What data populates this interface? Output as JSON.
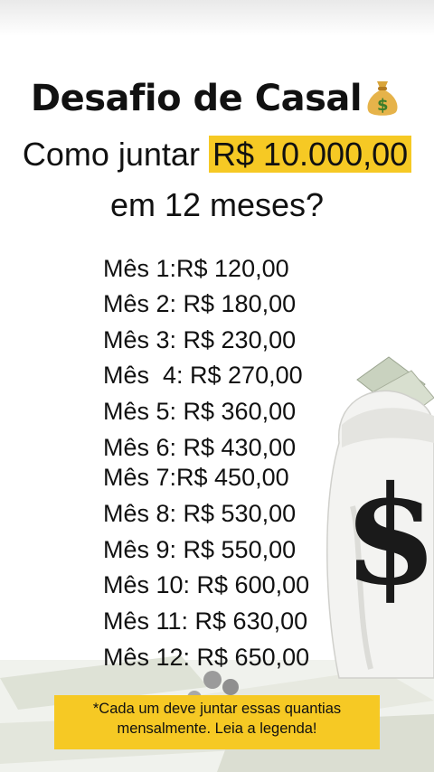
{
  "title": "Desafio de Casal",
  "title_icon": "money-bag-icon",
  "subtitle": {
    "prefix": "Como juntar ",
    "amount": "R$ 10.000,00",
    "line2": "em 12 meses?"
  },
  "months": [
    "Mês 1:R$ 120,00",
    "Mês 2: R$ 180,00",
    "Mês 3: R$ 230,00",
    "Mês  4: R$ 270,00",
    "Mês 5: R$ 360,00",
    "Mês 6: R$ 430,00",
    "Mês 7:R$ 450,00",
    "Mês 8: R$ 530,00",
    "Mês 9: R$ 550,00",
    "Mês 10: R$ 600,00",
    "Mês 11: R$ 630,00",
    "Mês 12: R$ 650,00"
  ],
  "footnote": {
    "line1": "*Cada um deve juntar essas quantias",
    "line2": "mensalmente. Leia a legenda!"
  },
  "colors": {
    "highlight": "#f6c924",
    "text": "#111111"
  }
}
